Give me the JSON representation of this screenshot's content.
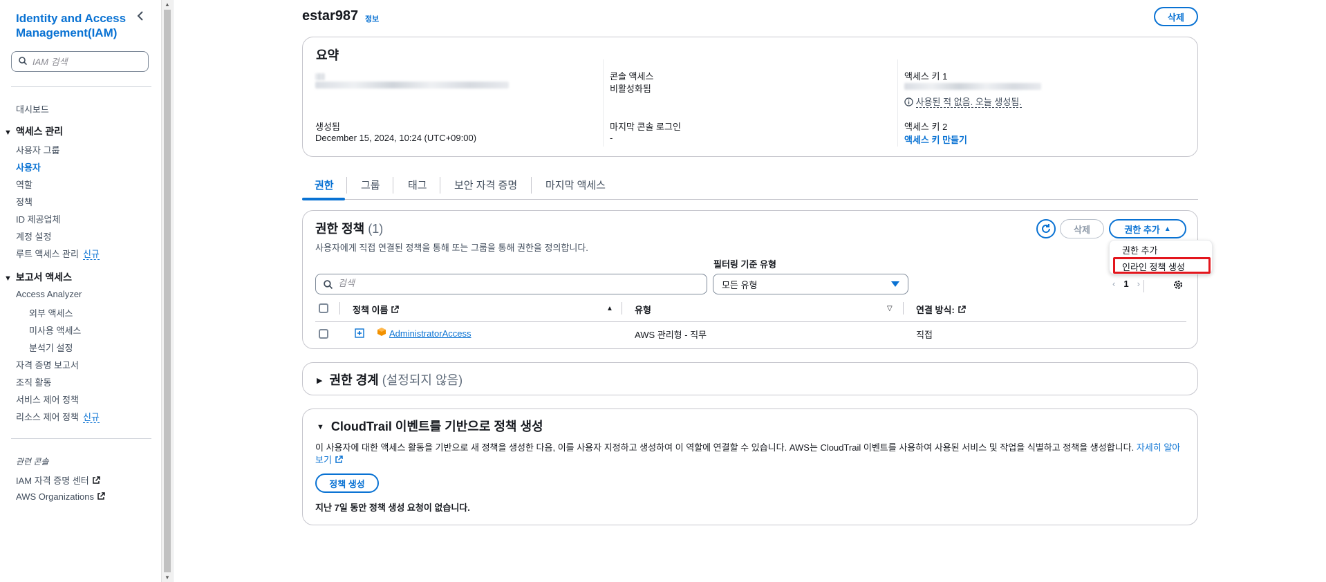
{
  "sidebar": {
    "title": "Identity and Access Management(IAM)",
    "search_placeholder": "IAM 검색",
    "dashboard": "대시보드",
    "access_mgmt": {
      "label": "액세스 관리",
      "items": [
        "사용자 그룹",
        "사용자",
        "역할",
        "정책",
        "ID 제공업체",
        "계정 설정",
        "루트 액세스 관리"
      ],
      "active_index": 1
    },
    "new_badge": "신규",
    "reports": {
      "label": "보고서 액세스",
      "access_analyzer": "Access Analyzer",
      "analyzer_items": [
        "외부 액세스",
        "미사용 액세스",
        "분석기 설정"
      ],
      "items": [
        "자격 증명 보고서",
        "조직 활동",
        "서비스 제어 정책",
        "리소스 제어 정책"
      ]
    },
    "related_label": "관련 콘솔",
    "related": [
      "IAM 자격 증명 센터",
      "AWS Organizations"
    ]
  },
  "header": {
    "title": "estar987",
    "info": "정보",
    "delete_button": "삭제"
  },
  "summary": {
    "title": "요약",
    "console_access_label": "콘솔 액세스",
    "console_access_value": "비활성화됨",
    "created_label": "생성됨",
    "created_value": "December 15, 2024, 10:24 (UTC+09:00)",
    "last_login_label": "마지막 콘솔 로그인",
    "last_login_value": "-",
    "access_key1_label": "액세스 키 1",
    "access_key1_note": "사용된 적 없음. 오늘 생성됨.",
    "access_key2_label": "액세스 키 2",
    "access_key2_link": "액세스 키 만들기"
  },
  "tabs": [
    "권한",
    "그룹",
    "태그",
    "보안 자격 증명",
    "마지막 액세스"
  ],
  "permissions": {
    "title": "권한 정책",
    "count": "(1)",
    "description": "사용자에게 직접 연결된 정책을 통해 또는 그룹을 통해 권한을 정의합니다.",
    "delete_button": "삭제",
    "add_button": "권한 추가",
    "filter_label": "필터링 기준 유형",
    "search_placeholder": "검색",
    "filter_value": "모든 유형",
    "page": "1",
    "columns": [
      "정책 이름",
      "유형",
      "연결 방식:"
    ],
    "rows": [
      {
        "name": "AdministratorAccess",
        "type": "AWS 관리형 - 직무",
        "attached": "직접"
      }
    ],
    "dropdown": [
      "권한 추가",
      "인라인 정책 생성"
    ]
  },
  "boundary": {
    "title": "권한 경계",
    "subtitle": "(설정되지 않음)"
  },
  "cloudtrail": {
    "title": "CloudTrail 이벤트를 기반으로 정책 생성",
    "paragraph": "이 사용자에 대한 액세스 활동을 기반으로 새 정책을 생성한 다음, 이를 사용자 지정하고 생성하여 이 역할에 연결할 수 있습니다. AWS는 CloudTrail 이벤트를 사용하여 사용된 서비스 및 작업을 식별하고 정책을 생성합니다.",
    "learn_more": "자세히 알아보기",
    "generate_button": "정책 생성",
    "note": "지난 7일 동안 정책 생성 요청이 없습니다."
  },
  "colors": {
    "accent": "#0972d3",
    "highlight": "#e3161d",
    "text": "#16191f"
  }
}
